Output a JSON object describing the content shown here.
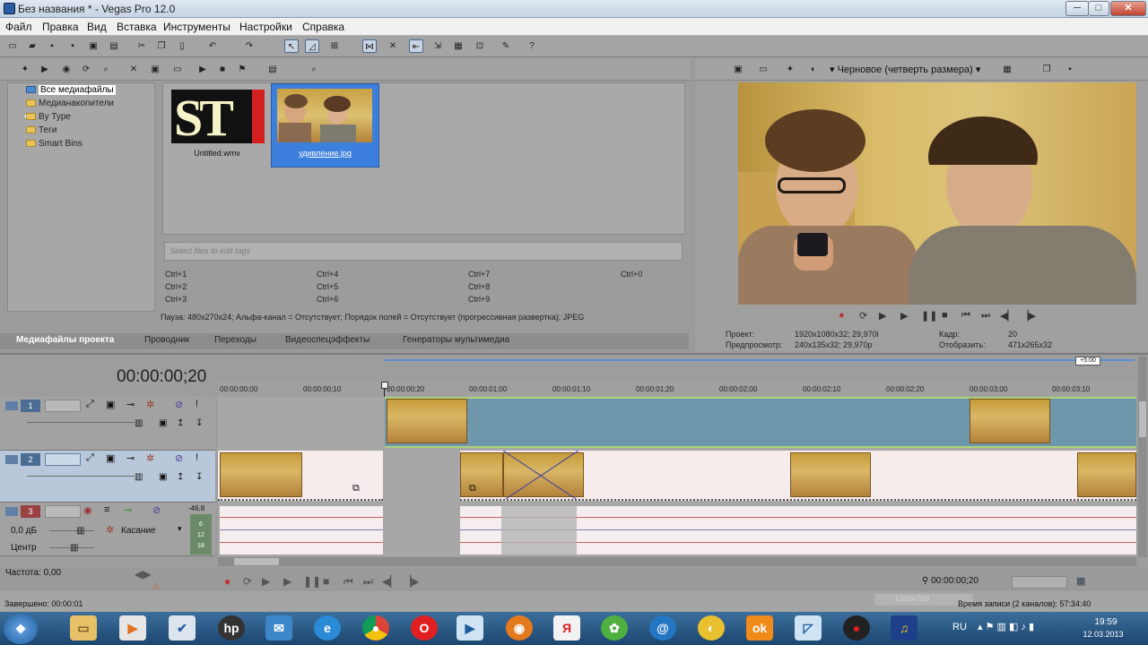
{
  "window": {
    "title": "Без названия * - Vegas Pro 12.0",
    "min": "─",
    "max": "□",
    "close": "✕"
  },
  "menu": [
    "Файл",
    "Правка",
    "Вид",
    "Вставка",
    "Инструменты",
    "Настройки",
    "Справка"
  ],
  "explorer": {
    "tree": [
      {
        "label": "Все медиафайлы",
        "selected": true
      },
      {
        "label": "Медианакопители"
      },
      {
        "label": "By Type",
        "expand": "+"
      },
      {
        "label": "Теги"
      },
      {
        "label": "Smart Bins"
      }
    ],
    "media": [
      {
        "name": "Untitled.wmv",
        "selected": false,
        "text": "ST"
      },
      {
        "name": "удивление.jpg",
        "selected": true
      }
    ],
    "tag_placeholder": "Select files to edit tags",
    "shortcuts": [
      "Ctrl+1",
      "Ctrl+2",
      "Ctrl+3",
      "Ctrl+4",
      "Ctrl+5",
      "Ctrl+6",
      "Ctrl+7",
      "Ctrl+8",
      "Ctrl+9",
      "Ctrl+0"
    ],
    "status": "Пауза: 480x270x24; Альфа-канал = Отсутствует; Порядок полей = Отсутствует (прогрессивная развертка); JPEG",
    "tabs": [
      "Медиафайлы проекта",
      "Проводник",
      "Переходы",
      "Видеоспецэффекты",
      "Генераторы мультимедиа"
    ]
  },
  "preview": {
    "quality": "Черновое (четверть размера)",
    "project_label": "Проект:",
    "project_value": "1920x1080x32; 29,970i",
    "preview_label": "Предпросмотр:",
    "preview_value": "240x135x32; 29,970p",
    "frame_label": "Кадр:",
    "frame_value": "20",
    "display_label": "Отобразить:",
    "display_value": "471x265x32"
  },
  "timeline": {
    "timecode": "00:00:00;20",
    "ruler_labels": [
      "00:00:00;00",
      "00:00:00;10",
      "00:00:00;20",
      "00:00:01;00",
      "00:00:01;10",
      "00:00:01;20",
      "00:00:02;00",
      "00:00:02;10",
      "00:00:02;20",
      "00:00:03;00",
      "00:00:03;10"
    ],
    "marker": "+5:00",
    "tracks": [
      {
        "number": "1",
        "kind": "video"
      },
      {
        "number": "2",
        "kind": "video"
      },
      {
        "number": "3",
        "kind": "audio",
        "volume": "0,0 дБ",
        "pan": "Центр",
        "mode": "Касание",
        "levels": [
          "-46,8",
          "6",
          "12",
          "18"
        ]
      }
    ],
    "rate": "Частота: 0,00",
    "end_timecode": "00:00:00;20",
    "record_time": "Время записи (2 каналов): 57:34:40",
    "done": "Завершено: 00:00:01",
    "size_badge": "1366x768"
  },
  "taskbar": {
    "lang": "RU",
    "time": "19:59",
    "date": "12.03.2013"
  }
}
